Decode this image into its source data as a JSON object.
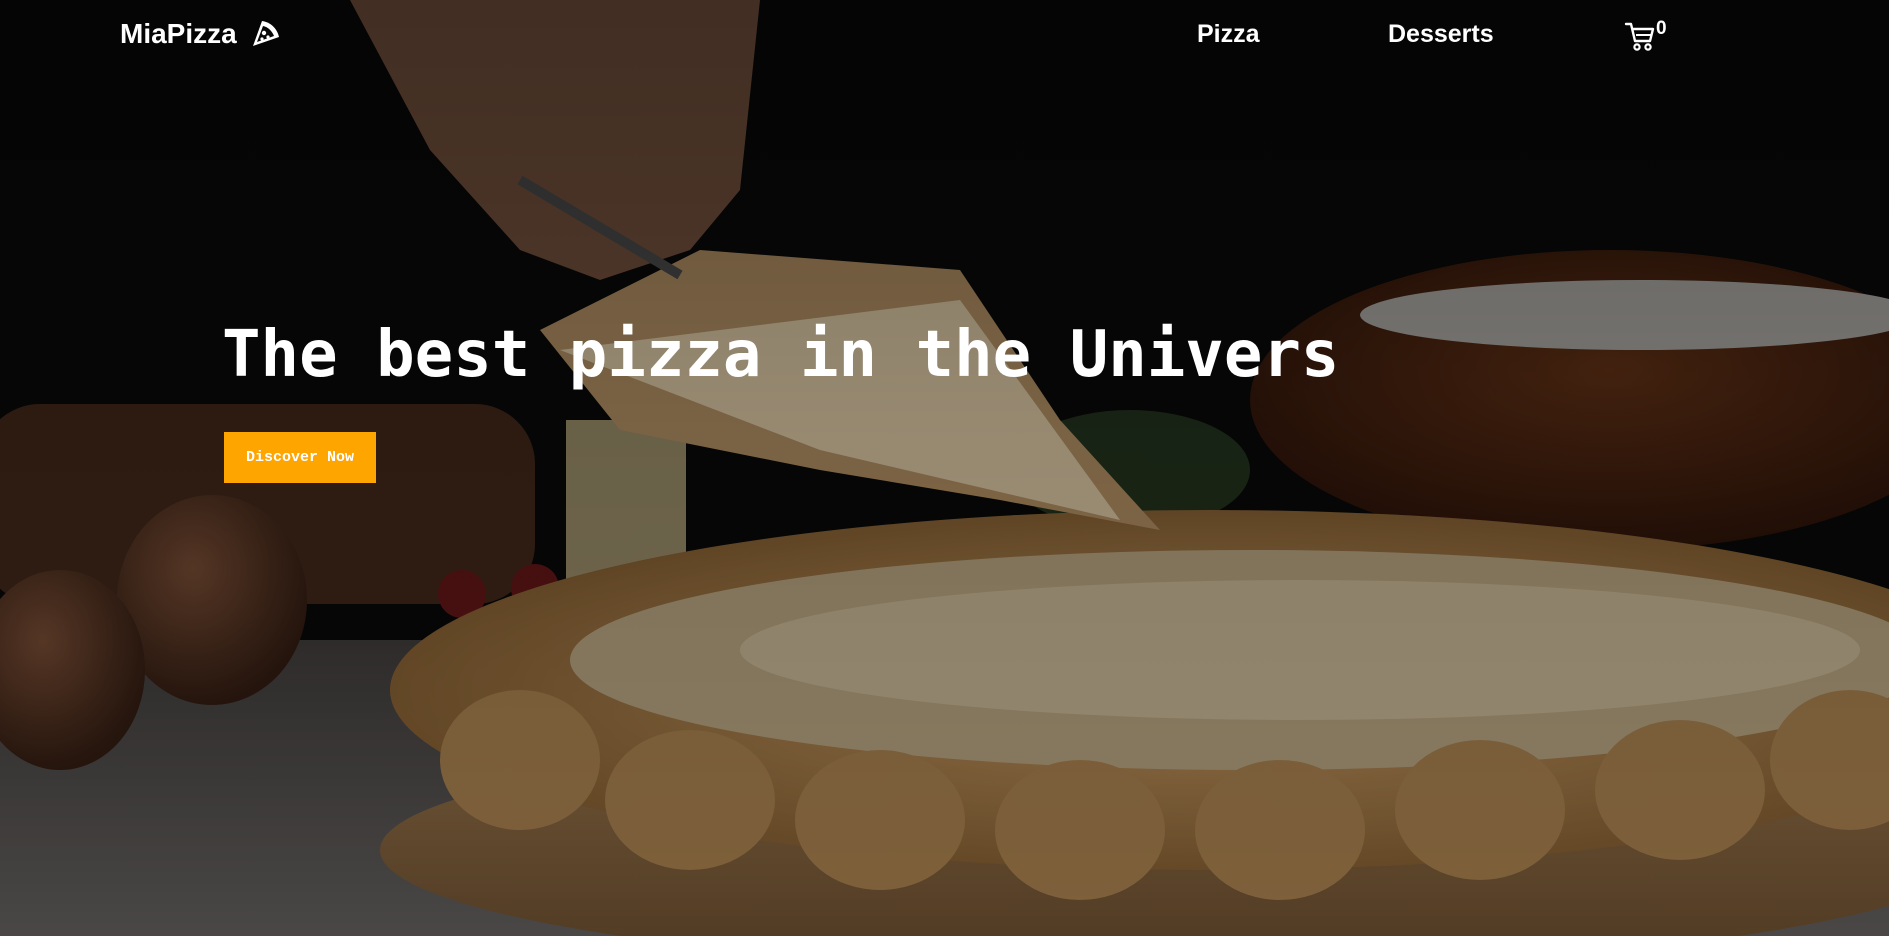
{
  "brand": {
    "name": "MiaPizza",
    "icon": "pizza-slice-icon"
  },
  "nav": {
    "links": [
      {
        "label": "Pizza"
      },
      {
        "label": "Desserts"
      }
    ],
    "cart": {
      "icon": "shopping-cart-icon",
      "count": "0"
    }
  },
  "hero": {
    "title": "The best pizza in the Univers",
    "cta_label": "Discover Now",
    "image": "pizza-hero-photo"
  },
  "colors": {
    "accent": "#ffa500",
    "text": "#ffffff",
    "background": "#070707"
  }
}
